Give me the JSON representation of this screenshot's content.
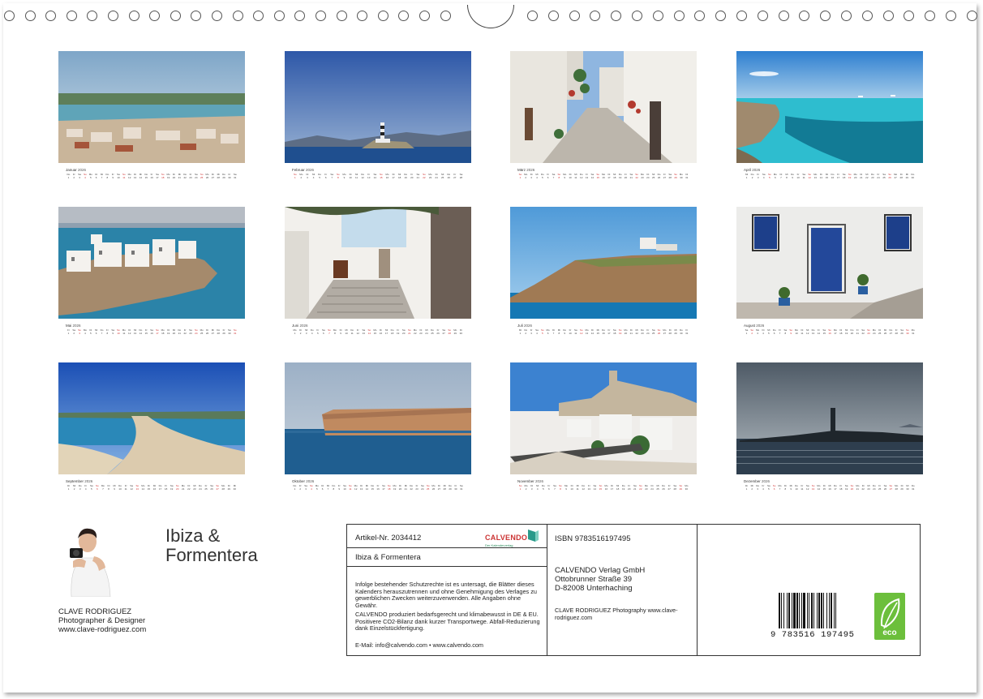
{
  "months": [
    {
      "name": "Januar",
      "year": "2026",
      "startDay": 3,
      "days": 31
    },
    {
      "name": "Februar",
      "year": "2026",
      "startDay": 6,
      "days": 28
    },
    {
      "name": "März",
      "year": "2026",
      "startDay": 6,
      "days": 31
    },
    {
      "name": "April",
      "year": "2026",
      "startDay": 2,
      "days": 30
    },
    {
      "name": "Mai",
      "year": "2026",
      "startDay": 4,
      "days": 31
    },
    {
      "name": "Juni",
      "year": "2026",
      "startDay": 0,
      "days": 30
    },
    {
      "name": "Juli",
      "year": "2026",
      "startDay": 2,
      "days": 31
    },
    {
      "name": "August",
      "year": "2026",
      "startDay": 5,
      "days": 31
    },
    {
      "name": "September",
      "year": "2026",
      "startDay": 1,
      "days": 30
    },
    {
      "name": "Oktober",
      "year": "2026",
      "startDay": 3,
      "days": 31
    },
    {
      "name": "November",
      "year": "2026",
      "startDay": 6,
      "days": 30
    },
    {
      "name": "Dezember",
      "year": "2026",
      "startDay": 1,
      "days": 31
    }
  ],
  "weekday_abbr": [
    "Mo",
    "Di",
    "Mi",
    "Do",
    "Fr",
    "Sa",
    "So"
  ],
  "title_line1": "Ibiza &",
  "title_line2": "Formentera",
  "author": {
    "name": "CLAVE RODRIGUEZ",
    "role": "Photographer & Designer",
    "website": "www.clave-rodriguez.com"
  },
  "infobox": {
    "article": "Artikel-Nr. 2034412",
    "logo_word": "CALVENDO",
    "logo_tag": "Der Kalenderverlag",
    "product_title": "Ibiza & Formentera",
    "legal_1": "Infolge bestehender Schutzrechte ist es untersagt, die Blätter dieses Kalenders herauszutrennen und ohne Genehmigung des Verlages zu gewerblichen Zwecken weiterzuverwenden. Alle Angaben ohne Gewähr.",
    "legal_2": "CALVENDO produziert bedarfsgerecht und klimabewusst in DE & EU. Positivere CO2-Bilanz dank kurzer Transportwege. Abfall-Reduzierung dank Einzelstückfertigung.",
    "contact": "E-Mail: info@calvendo.com • www.calvendo.com",
    "isbn": "ISBN 9783516197495",
    "publisher_name": "CALVENDO Verlag GmbH",
    "publisher_street": "Ottobrunner Straße 39",
    "publisher_city": "D-82008 Unterhaching",
    "photo_credit": "CLAVE RODRIGUEZ Photography www.clave-rodriguez.com",
    "barcode_number": "9 783516 197495",
    "eco_label": "eco"
  },
  "colors": {
    "sunday_red": "#d03030",
    "eco_green": "#6cbf3c",
    "calvendo_red": "#cc3333"
  }
}
